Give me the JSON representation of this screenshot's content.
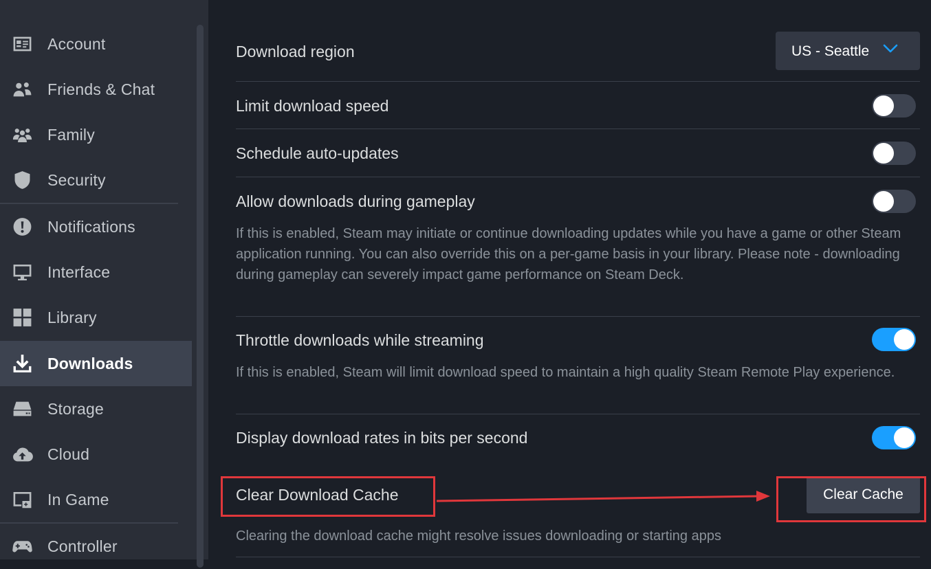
{
  "sidebar": {
    "items": [
      {
        "label": "Account",
        "icon": "account-card-icon"
      },
      {
        "label": "Friends & Chat",
        "icon": "friends-icon"
      },
      {
        "label": "Family",
        "icon": "family-icon"
      },
      {
        "label": "Security",
        "icon": "shield-icon"
      },
      {
        "label": "Notifications",
        "icon": "exclamation-icon"
      },
      {
        "label": "Interface",
        "icon": "monitor-icon"
      },
      {
        "label": "Library",
        "icon": "grid-icon"
      },
      {
        "label": "Downloads",
        "icon": "download-icon",
        "active": true
      },
      {
        "label": "Storage",
        "icon": "drive-icon"
      },
      {
        "label": "Cloud",
        "icon": "cloud-icon"
      },
      {
        "label": "In Game",
        "icon": "in-game-icon"
      },
      {
        "label": "Controller",
        "icon": "controller-icon"
      }
    ]
  },
  "main": {
    "download_region": {
      "label": "Download region",
      "value": "US - Seattle"
    },
    "limit_speed": {
      "label": "Limit download speed",
      "enabled": false
    },
    "schedule_updates": {
      "label": "Schedule auto-updates",
      "enabled": false
    },
    "allow_gameplay": {
      "label": "Allow downloads during gameplay",
      "enabled": false,
      "description": "If this is enabled, Steam may initiate or continue downloading updates while you have a game or other Steam application running. You can also override this on a per-game basis in your library. Please note - downloading during gameplay can severely impact game performance on Steam Deck."
    },
    "throttle_streaming": {
      "label": "Throttle downloads while streaming",
      "enabled": true,
      "description": "If this is enabled, Steam will limit download speed to maintain a high quality Steam Remote Play experience."
    },
    "bits_per_second": {
      "label": "Display download rates in bits per second",
      "enabled": true
    },
    "clear_cache": {
      "label": "Clear Download Cache",
      "button": "Clear Cache",
      "description": "Clearing the download cache might resolve issues downloading or starting apps"
    }
  },
  "colors": {
    "accent": "#1a9fff",
    "annotation": "#e0373b",
    "sidebar_bg": "#2a2e37",
    "main_bg": "#1b1f27"
  }
}
